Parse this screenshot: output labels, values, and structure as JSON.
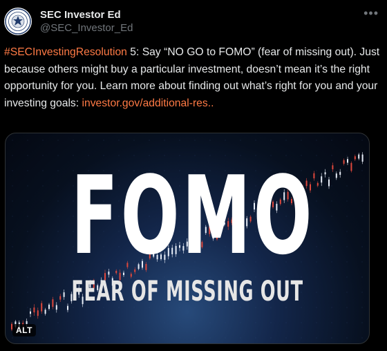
{
  "account": {
    "display_name": "SEC Investor Ed",
    "handle": "@SEC_Investor_Ed",
    "avatar_icon": "sec-seal-icon"
  },
  "more_icon": "more-options-icon",
  "tweet": {
    "hashtag": "#SECInvestingResolution",
    "text": " 5: Say “NO GO to FOMO” (fear of missing out). Just because others might buy a particular investment, doesn’t mean it’s the right opportunity for you. Learn more about finding out what’s right for you and your investing goals:",
    "link": "investor.gov/additional-res..",
    "link_color": "#ff7a45"
  },
  "media": {
    "headline": "FOMO",
    "subtitle": "FEAR OF MISSING OUT",
    "alt_label": "ALT"
  }
}
